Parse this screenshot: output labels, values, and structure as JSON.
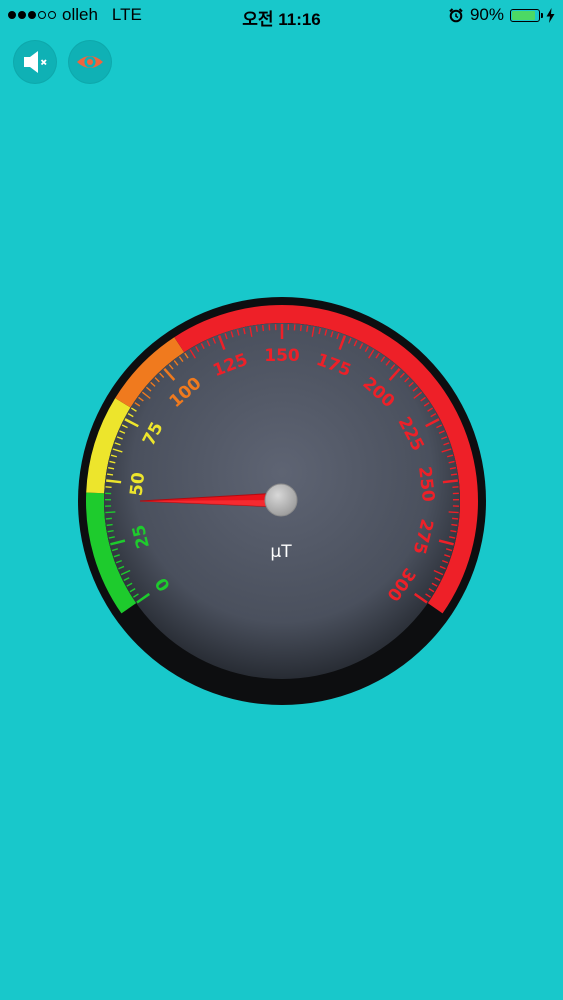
{
  "status_bar": {
    "carrier": "olleh",
    "network": "LTE",
    "time": "오전 11:16",
    "battery": "90%",
    "battery_level": 0.9,
    "signal_bars_filled": 3,
    "signal_bars_total": 5
  },
  "controls": {
    "mute_icon": "speaker-muted-icon",
    "eye_icon": "eye-icon"
  },
  "gauge": {
    "unit": "μT",
    "min": 0,
    "max": 300,
    "value": 42,
    "tick_labels": [
      "0",
      "25",
      "50",
      "75",
      "100",
      "125",
      "150",
      "175",
      "200",
      "225",
      "250",
      "275",
      "300"
    ],
    "zones": [
      {
        "from": 0,
        "to": 45,
        "color": "#1ECB2D"
      },
      {
        "from": 45,
        "to": 80,
        "color": "#EDE52C"
      },
      {
        "from": 80,
        "to": 110,
        "color": "#F07A1E"
      },
      {
        "from": 110,
        "to": 300,
        "color": "#EE2028"
      }
    ]
  }
}
